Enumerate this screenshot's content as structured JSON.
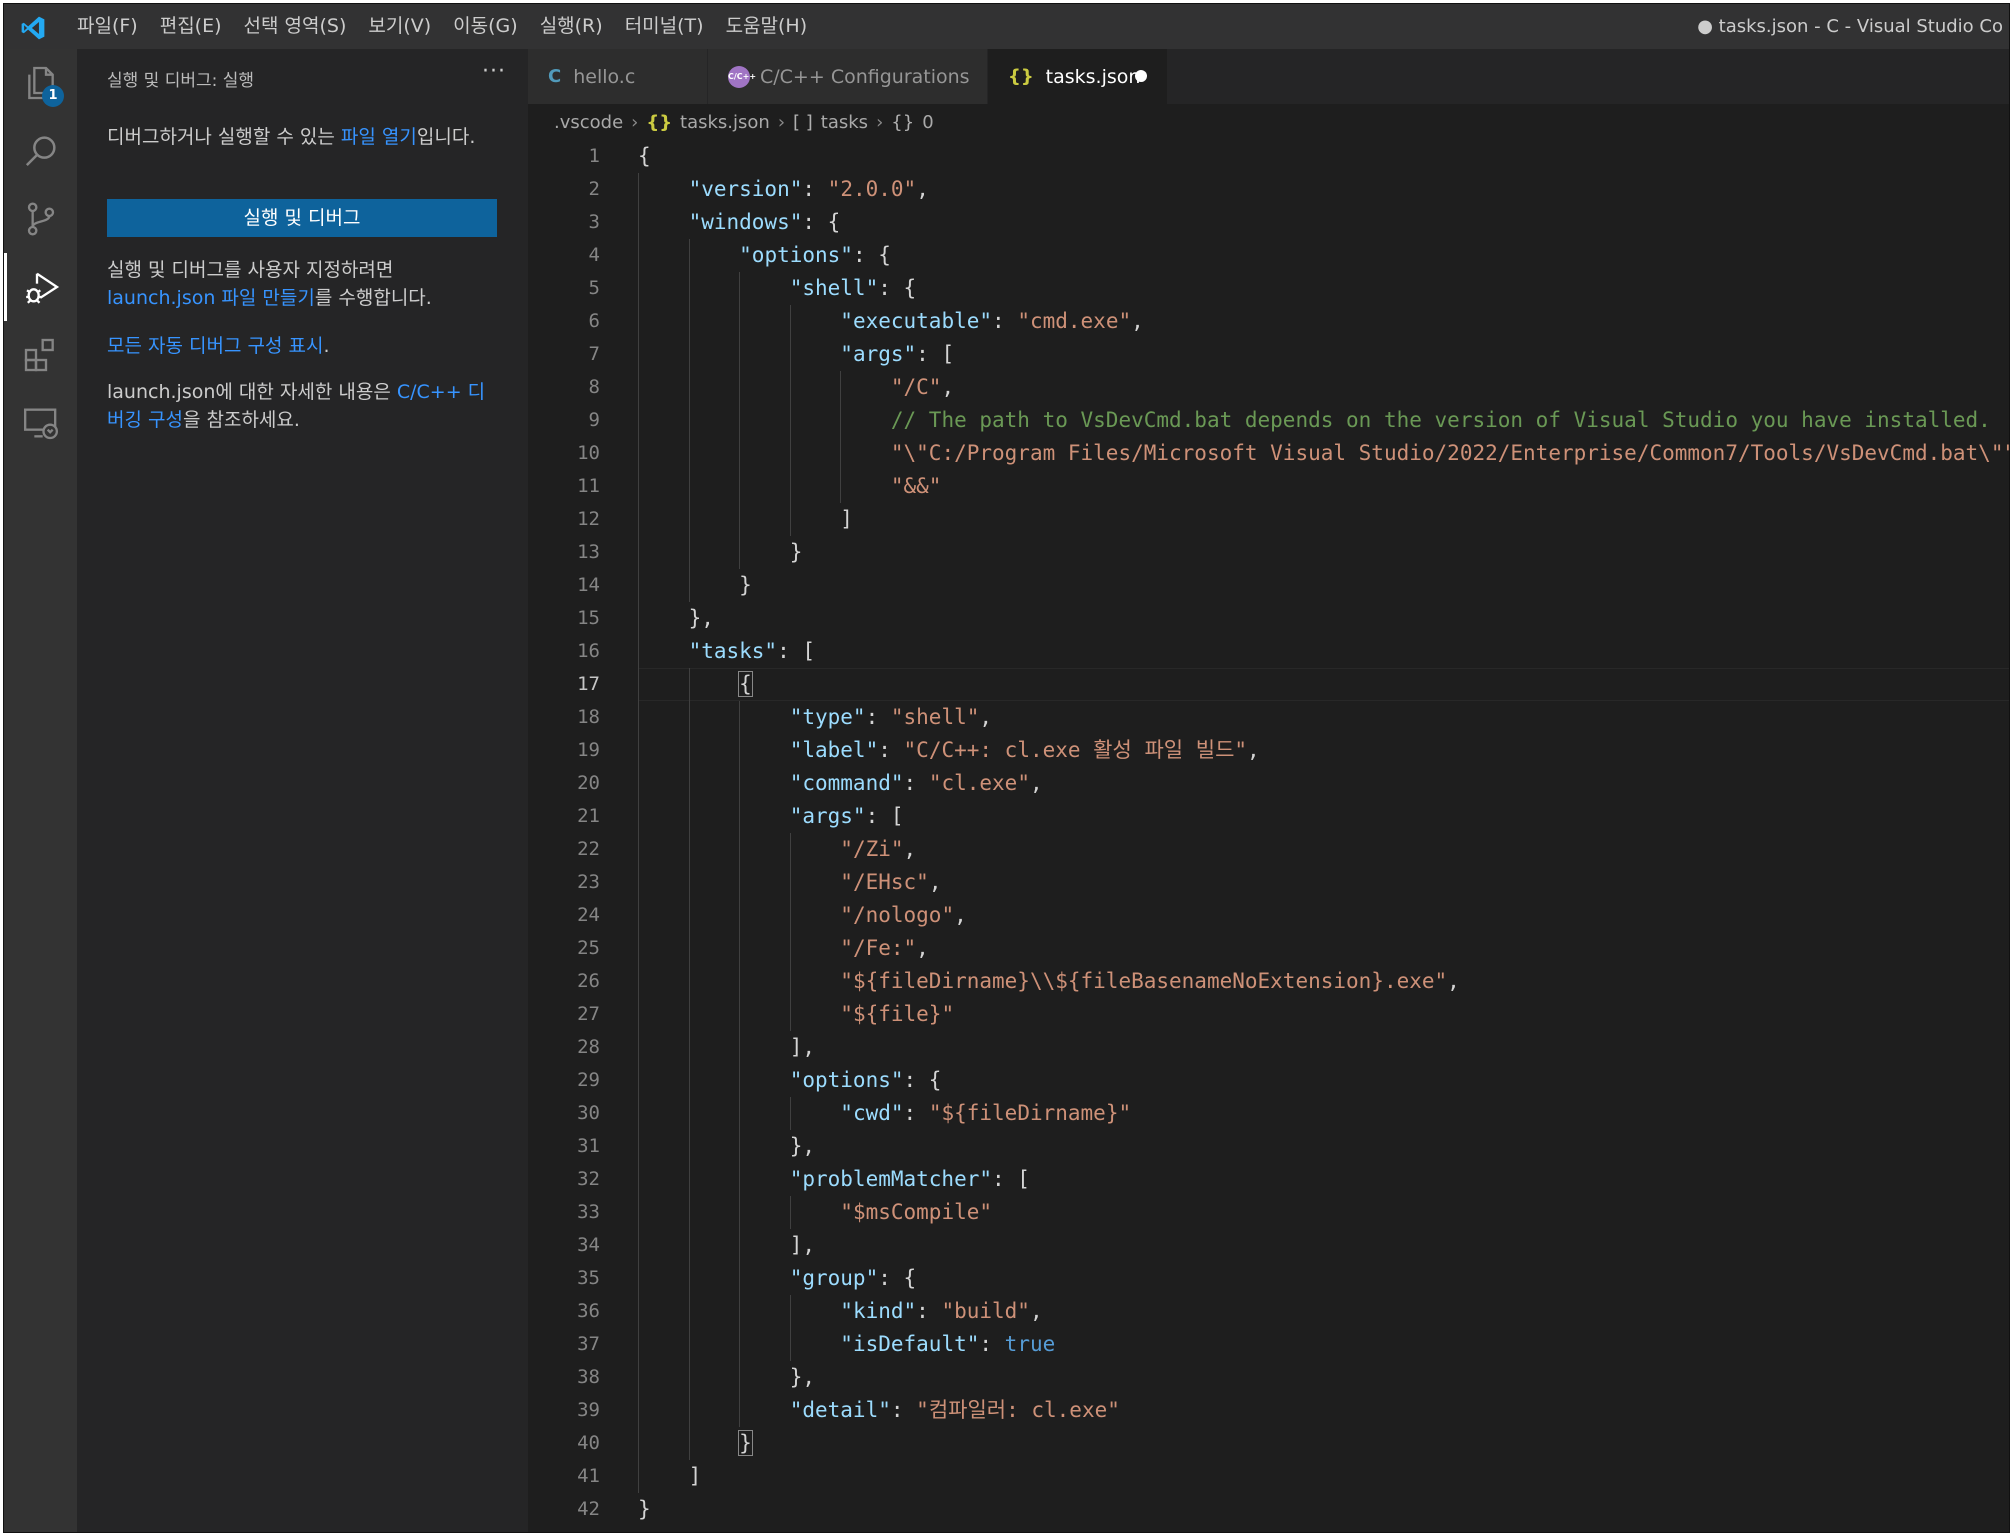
{
  "window_title": "● tasks.json - C - Visual Studio Co",
  "menu": [
    "파일(F)",
    "편집(E)",
    "선택 영역(S)",
    "보기(V)",
    "이동(G)",
    "실행(R)",
    "터미널(T)",
    "도움말(H)"
  ],
  "activity_bar": {
    "items": [
      "explorer-icon",
      "search-icon",
      "source-control-icon",
      "run-debug-icon",
      "extensions-icon",
      "remote-explorer-icon"
    ],
    "active": "run-debug-icon",
    "explorer_badge": "1"
  },
  "sidebar": {
    "title": "실행 및 디버그: 실행",
    "more": "···",
    "p1_pre": "디버그하거나 실행할 수 있는 ",
    "p1_link": "파일 열기",
    "p1_post": "입니다.",
    "run_button": "실행 및 디버그",
    "p2_pre": "실행 및 디버그를 사용자 지정하려면 ",
    "p2_link": "launch.json 파일 만들기",
    "p2_post": "를 수행합니다.",
    "p3_link": "모든 자동 디버그 구성 표시",
    "p3_post": ".",
    "p4_pre": "launch.json에 대한 자세한 내용은 ",
    "p4_link": "C/C++ 디버깅 구성",
    "p4_post": "을 참조하세요."
  },
  "tabs": [
    {
      "icon": "C",
      "label": "hello.c"
    },
    {
      "icon": "C/C++",
      "label": "C/C++ Configurations"
    },
    {
      "icon": "{}",
      "label": "tasks.json",
      "active": true,
      "modified": true
    }
  ],
  "breadcrumb": {
    "folder": ".vscode",
    "file_icon": "{}",
    "file": "tasks.json",
    "sym1_icon": "[ ]",
    "sym1": "tasks",
    "sym2_icon": "{}",
    "sym2": "0"
  },
  "editor": {
    "current_line": 17,
    "lines": [
      "{",
      "    \"version\": \"2.0.0\",",
      "    \"windows\": {",
      "        \"options\": {",
      "            \"shell\": {",
      "                \"executable\": \"cmd.exe\",",
      "                \"args\": [",
      "                    \"/C\",",
      "                    // The path to VsDevCmd.bat depends on the version of Visual Studio you have installed.",
      "                    \"\\\"C:/Program Files/Microsoft Visual Studio/2022/Enterprise/Common7/Tools/VsDevCmd.bat\\\"\",",
      "                    \"&&\"",
      "                ]",
      "            }",
      "        }",
      "    },",
      "    \"tasks\": [",
      "        {",
      "            \"type\": \"shell\",",
      "            \"label\": \"C/C++: cl.exe 활성 파일 빌드\",",
      "            \"command\": \"cl.exe\",",
      "            \"args\": [",
      "                \"/Zi\",",
      "                \"/EHsc\",",
      "                \"/nologo\",",
      "                \"/Fe:\",",
      "                \"${fileDirname}\\\\${fileBasenameNoExtension}.exe\",",
      "                \"${file}\"",
      "            ],",
      "            \"options\": {",
      "                \"cwd\": \"${fileDirname}\"",
      "            },",
      "            \"problemMatcher\": [",
      "                \"$msCompile\"",
      "            ],",
      "            \"group\": {",
      "                \"kind\": \"build\",",
      "                \"isDefault\": true",
      "            },",
      "            \"detail\": \"컴파일러: cl.exe\"",
      "        }",
      "    ]",
      "}"
    ]
  },
  "colors": {
    "key": "#9cdcfe",
    "string": "#ce9178",
    "comment": "#6a9955",
    "keyword": "#569cd6",
    "accent": "#0e639c",
    "link": "#3794ff"
  }
}
